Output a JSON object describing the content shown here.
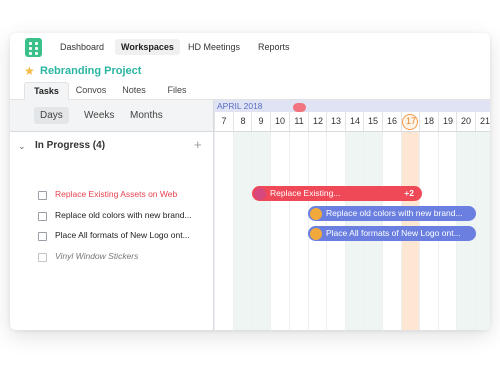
{
  "nav": {
    "items": [
      {
        "label": "Dashboard",
        "active": false
      },
      {
        "label": "Workspaces",
        "active": true
      },
      {
        "label": "HD Meetings",
        "active": false
      },
      {
        "label": "Reports",
        "active": false
      }
    ]
  },
  "project": {
    "title": "Rebranding Project",
    "star_icon": "star-icon",
    "accent": "#2bb5a3"
  },
  "tabs": [
    "Tasks",
    "Convos",
    "Notes",
    "Files"
  ],
  "zoom": {
    "options": [
      "Days",
      "Weeks",
      "Months"
    ],
    "selected": "Days"
  },
  "group": {
    "label": "In Progress (4)",
    "add_icon": "plus-icon",
    "collapse_icon": "chevron-down-icon"
  },
  "tasks": [
    {
      "label": "Replace Existing Assets on Web",
      "style": "highlight"
    },
    {
      "label": "Replace old colors with new brand...",
      "style": "normal"
    },
    {
      "label": "Place All formats of New Logo ont...",
      "style": "normal"
    },
    {
      "label": "Vinyl Window Stickers",
      "style": "muted"
    }
  ],
  "timeline": {
    "month": "APRIL 2018",
    "days": [
      "7",
      "8",
      "9",
      "10",
      "11",
      "12",
      "13",
      "14",
      "15",
      "16",
      "17",
      "18",
      "19",
      "20",
      "21"
    ],
    "today": "17",
    "colors": {
      "red_bar": "#ef4857",
      "blue_bar": "#6a7fe0",
      "today": "#f39a4b",
      "weekend": "#eef5f3"
    },
    "bars": [
      {
        "label": "Replace Existing...",
        "extra": "+2",
        "color": "red"
      },
      {
        "label": "Replace old colors with new brand...",
        "extra": "",
        "color": "blue"
      },
      {
        "label": "Place All formats of New Logo ont...",
        "extra": "",
        "color": "blue"
      }
    ]
  }
}
